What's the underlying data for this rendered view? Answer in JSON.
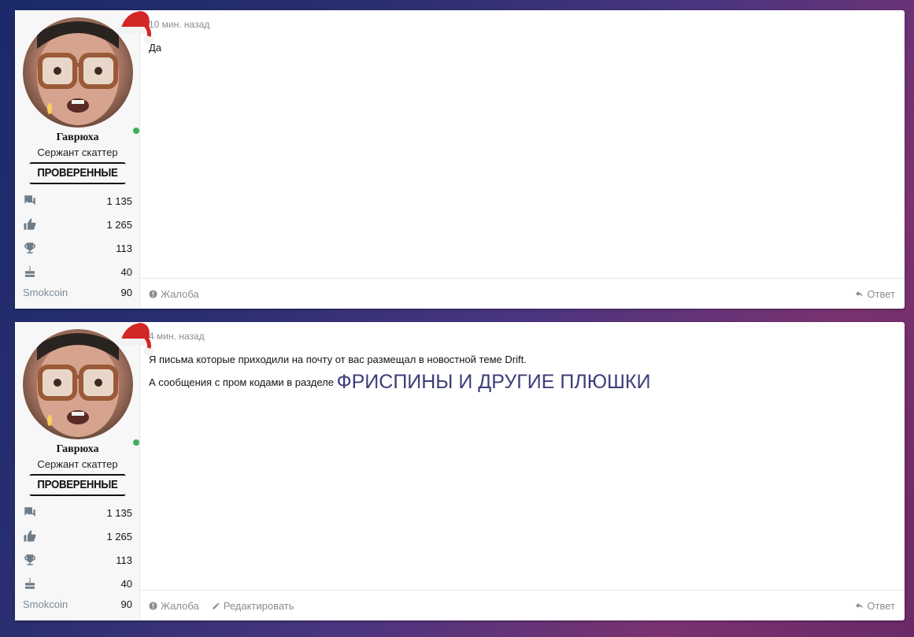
{
  "posts": [
    {
      "user": {
        "name": "Гаврюха",
        "title": "Сержант скаттер",
        "banner": "ПРОВЕРЕННЫЕ",
        "messages": "1 135",
        "reactions": "1 265",
        "trophies": "113",
        "age": "40",
        "coin_label": "Smokcoin",
        "coin_value": "90"
      },
      "time": "10 мин. назад",
      "body_lines": [
        "Да"
      ],
      "actions": {
        "report": "Жалоба",
        "reply": "Ответ"
      }
    },
    {
      "user": {
        "name": "Гаврюха",
        "title": "Сержант скаттер",
        "banner": "ПРОВЕРЕННЫЕ",
        "messages": "1 135",
        "reactions": "1 265",
        "trophies": "113",
        "age": "40",
        "coin_label": "Smokcoin",
        "coin_value": "90"
      },
      "time": "4 мин. назад",
      "body_line1": "Я письма которые приходили на почту от вас размещал в новостной теме Drift.",
      "body_line2_prefix": "А сообщения с пром кодами в разделе",
      "body_line2_link": "ФРИСПИНЫ И ДРУГИЕ ПЛЮШКИ",
      "actions": {
        "report": "Жалоба",
        "edit": "Редактировать",
        "reply": "Ответ"
      }
    }
  ],
  "icons": {
    "messages": "chat-bubbles-icon",
    "reactions": "thumbs-up-icon",
    "trophies": "trophy-icon",
    "age": "birthday-cake-icon",
    "report": "exclamation-circle-icon",
    "edit": "pencil-icon",
    "reply": "reply-arrow-icon"
  },
  "colors": {
    "online": "#3dae5a",
    "link": "#3c3d7a",
    "muted": "#8c8c8c",
    "icon": "#6d7c89"
  }
}
